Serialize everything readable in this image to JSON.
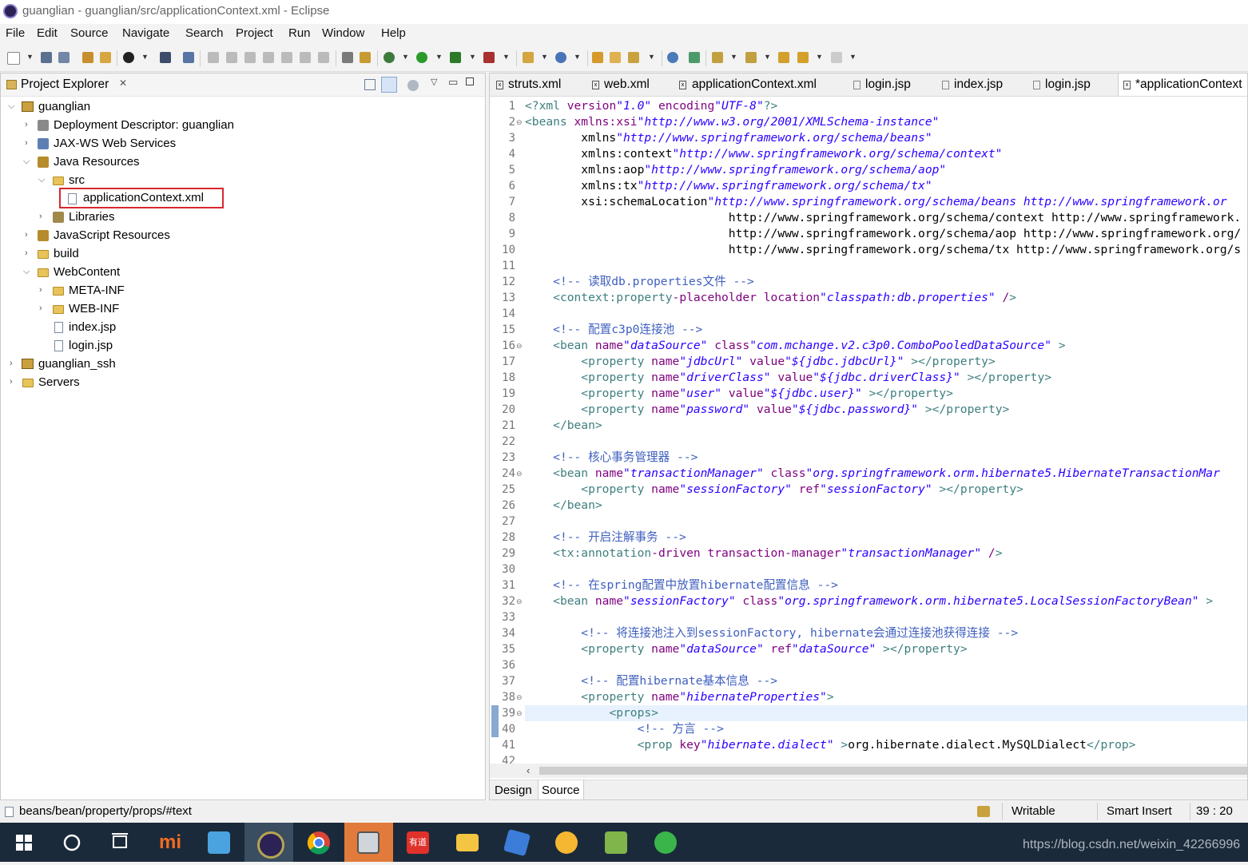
{
  "window": {
    "title": "guanglian - guanglian/src/applicationContext.xml - Eclipse"
  },
  "menu": [
    "File",
    "Edit",
    "Source",
    "Navigate",
    "Search",
    "Project",
    "Run",
    "Window",
    "Help"
  ],
  "explorer": {
    "title": "Project Explorer",
    "tree": [
      "guanglian",
      "Deployment Descriptor: guanglian",
      "JAX-WS Web Services",
      "Java Resources",
      "src",
      "applicationContext.xml",
      "Libraries",
      "JavaScript Resources",
      "build",
      "WebContent",
      "META-INF",
      "WEB-INF",
      "index.jsp",
      "login.jsp",
      "guanglian_ssh",
      "Servers"
    ]
  },
  "editor": {
    "tabs": [
      "struts.xml",
      "web.xml",
      "applicationContext.xml",
      "login.jsp",
      "index.jsp",
      "login.jsp",
      "*applicationContext"
    ],
    "active_tab": 6,
    "line_numbers": [
      "1",
      "2",
      "3",
      "4",
      "5",
      "6",
      "7",
      "8",
      "9",
      "10",
      "11",
      "12",
      "13",
      "14",
      "15",
      "16",
      "17",
      "18",
      "19",
      "20",
      "21",
      "22",
      "23",
      "24",
      "25",
      "26",
      "27",
      "28",
      "29",
      "30",
      "31",
      "32",
      "33",
      "34",
      "35",
      "36",
      "37",
      "38",
      "39",
      "40",
      "41",
      "42"
    ],
    "code": [
      "<?xml version=\"1.0\" encoding=\"UTF-8\"?>",
      "<beans xmlns:xsi=\"http://www.w3.org/2001/XMLSchema-instance\"",
      "        xmlns=\"http://www.springframework.org/schema/beans\"",
      "        xmlns:context=\"http://www.springframework.org/schema/context\"",
      "        xmlns:aop=\"http://www.springframework.org/schema/aop\"",
      "        xmlns:tx=\"http://www.springframework.org/schema/tx\"",
      "        xsi:schemaLocation=\"http://www.springframework.org/schema/beans http://www.springframework.or",
      "                             http://www.springframework.org/schema/context http://www.springframework.",
      "                             http://www.springframework.org/schema/aop http://www.springframework.org/",
      "                             http://www.springframework.org/schema/tx http://www.springframework.org/s",
      "",
      "    <!-- 读取db.properties文件 -->",
      "    <context:property-placeholder location=\"classpath:db.properties\" />",
      "",
      "    <!-- 配置c3p0连接池 -->",
      "    <bean name=\"dataSource\" class=\"com.mchange.v2.c3p0.ComboPooledDataSource\" >",
      "        <property name=\"jdbcUrl\" value=\"${jdbc.jdbcUrl}\" ></property>",
      "        <property name=\"driverClass\" value=\"${jdbc.driverClass}\" ></property>",
      "        <property name=\"user\" value=\"${jdbc.user}\" ></property>",
      "        <property name=\"password\" value=\"${jdbc.password}\" ></property>",
      "    </bean>",
      "",
      "    <!-- 核心事务管理器 -->",
      "    <bean name=\"transactionManager\" class=\"org.springframework.orm.hibernate5.HibernateTransactionMar",
      "        <property name=\"sessionFactory\" ref=\"sessionFactory\" ></property>",
      "    </bean>",
      "",
      "    <!-- 开启注解事务 -->",
      "    <tx:annotation-driven transaction-manager=\"transactionManager\" />",
      "",
      "    <!-- 在spring配置中放置hibernate配置信息 -->",
      "    <bean name=\"sessionFactory\" class=\"org.springframework.orm.hibernate5.LocalSessionFactoryBean\" >",
      "",
      "        <!-- 将连接池注入到sessionFactory, hibernate会通过连接池获得连接 -->",
      "        <property name=\"dataSource\" ref=\"dataSource\" ></property>",
      "",
      "        <!-- 配置hibernate基本信息 -->",
      "        <property name=\"hibernateProperties\">",
      "            <props>",
      "                <!-- 方言 -->",
      "                <prop key=\"hibernate.dialect\" >org.hibernate.dialect.MySQLDialect</prop>",
      ""
    ],
    "bottom_tabs": [
      "Design",
      "Source"
    ]
  },
  "status": {
    "path": "beans/bean/property/props/#text",
    "mode": "Writable",
    "insert": "Smart Insert",
    "position": "39 : 20"
  },
  "taskbar": {
    "watermark": "https://blog.csdn.net/weixin_42266996"
  },
  "colors": {
    "tag": "#3f7f7f",
    "attr": "#7f007f",
    "value": "#2a00ff",
    "comment": "#3f5fbf",
    "highlight": "#e8f2fe",
    "selection_box": "#d9272e"
  }
}
